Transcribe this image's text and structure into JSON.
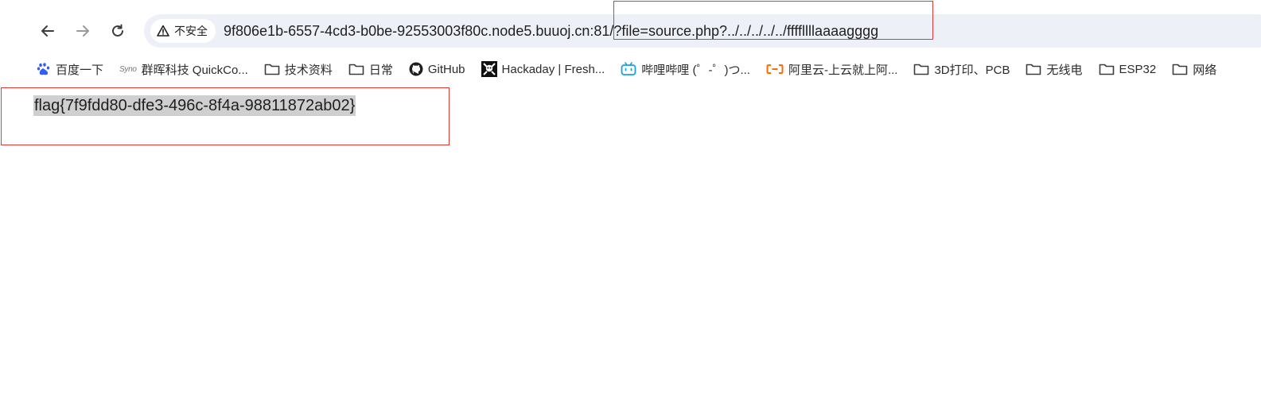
{
  "toolbar": {
    "back_icon": "arrow-left-icon",
    "forward_icon": "arrow-right-icon",
    "reload_icon": "reload-icon"
  },
  "omnibox": {
    "security_label": "不安全",
    "url": "9f806e1b-6557-4cd3-b0be-92553003f80c.node5.buuoj.cn:81/?file=source.php?../../../../../ffffllllaaaagggg"
  },
  "bookmarks": [
    {
      "label": "百度一下",
      "icon": "baidu-icon"
    },
    {
      "label": "群晖科技 QuickCo...",
      "icon": "synology-icon",
      "icon_text": "Syno"
    },
    {
      "label": "技术资料",
      "icon": "folder-icon"
    },
    {
      "label": "日常",
      "icon": "folder-icon"
    },
    {
      "label": "GitHub",
      "icon": "github-icon"
    },
    {
      "label": "Hackaday | Fresh...",
      "icon": "hackaday-icon"
    },
    {
      "label": "哔哩哔哩 (゜-゜)つ...",
      "icon": "bilibili-icon"
    },
    {
      "label": "阿里云-上云就上阿...",
      "icon": "aliyun-icon"
    },
    {
      "label": "3D打印、PCB",
      "icon": "folder-icon"
    },
    {
      "label": "无线电",
      "icon": "folder-icon"
    },
    {
      "label": "ESP32",
      "icon": "folder-icon"
    },
    {
      "label": "网络",
      "icon": "folder-icon"
    }
  ],
  "page": {
    "flag": "flag{7f9fdd80-dfe3-496c-8f4a-98811872ab02}"
  },
  "colors": {
    "omnibox_bg": "#edf0f7",
    "annotation_red": "#e53935",
    "selection_bg": "#cfcfcf"
  }
}
